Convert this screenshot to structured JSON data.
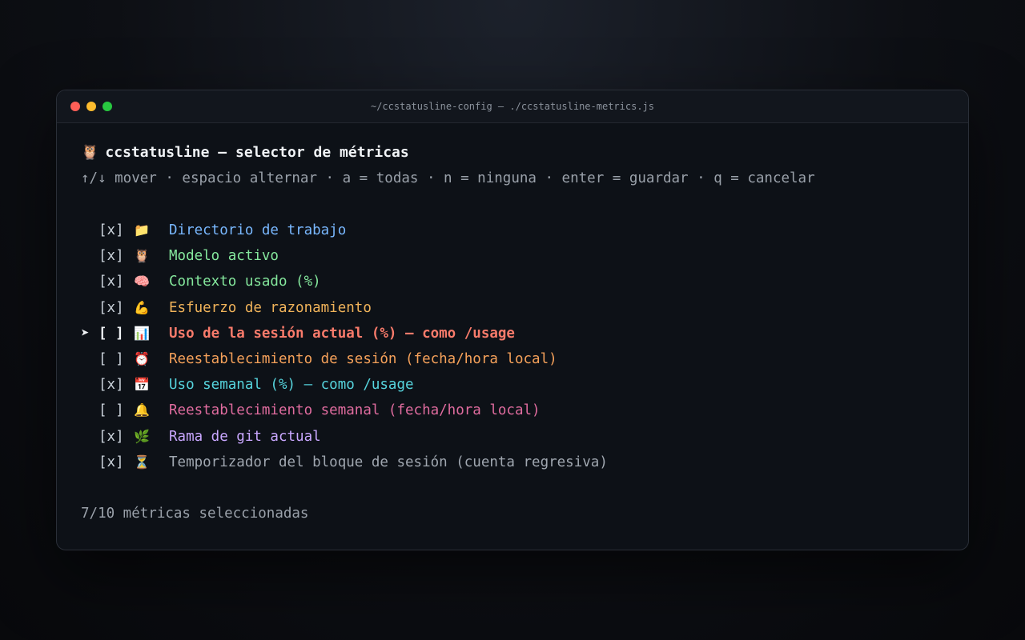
{
  "window": {
    "title": "~/ccstatusline-config — ./ccstatusline-metrics.js"
  },
  "header": {
    "emoji": "🦉",
    "title": "ccstatusline — selector de métricas",
    "hint": "↑/↓ mover · espacio alternar · a = todas · n = ninguna · enter = guardar · q = cancelar"
  },
  "metrics": [
    {
      "cursor": "",
      "check": "[x]",
      "icon": "📁",
      "label": "Directorio de trabajo",
      "color": "#79b8ff",
      "selected": false
    },
    {
      "cursor": "",
      "check": "[x]",
      "icon": "🦉",
      "label": "Modelo activo",
      "color": "#85e89d",
      "selected": false
    },
    {
      "cursor": "",
      "check": "[x]",
      "icon": "🧠",
      "label": "Contexto usado (%)",
      "color": "#85e89d",
      "selected": false
    },
    {
      "cursor": "",
      "check": "[x]",
      "icon": "💪",
      "label": "Esfuerzo de razonamiento",
      "color": "#f0b35a",
      "selected": false
    },
    {
      "cursor": "➤",
      "check": "[ ]",
      "icon": "📊",
      "label": "Uso de la sesión actual (%) — como /usage",
      "color": "#f97b6b",
      "selected": true
    },
    {
      "cursor": "",
      "check": "[ ]",
      "icon": "⏰",
      "label": "Reestablecimiento de sesión (fecha/hora local)",
      "color": "#f5a15a",
      "selected": false
    },
    {
      "cursor": "",
      "check": "[x]",
      "icon": "📅",
      "label": "Uso semanal (%) — como /usage",
      "color": "#56d4dd",
      "selected": false
    },
    {
      "cursor": "",
      "check": "[ ]",
      "icon": "🔔",
      "label": "Reestablecimiento semanal (fecha/hora local)",
      "color": "#e06c9f",
      "selected": false
    },
    {
      "cursor": "",
      "check": "[x]",
      "icon": "🌿",
      "label": "Rama de git actual",
      "color": "#c9a7ff",
      "selected": false
    },
    {
      "cursor": "",
      "check": "[x]",
      "icon": "⏳",
      "label": "Temporizador del bloque de sesión (cuenta regresiva)",
      "color": "#a0a7b0",
      "selected": false
    }
  ],
  "footer": {
    "summary": "7/10 métricas seleccionadas"
  }
}
